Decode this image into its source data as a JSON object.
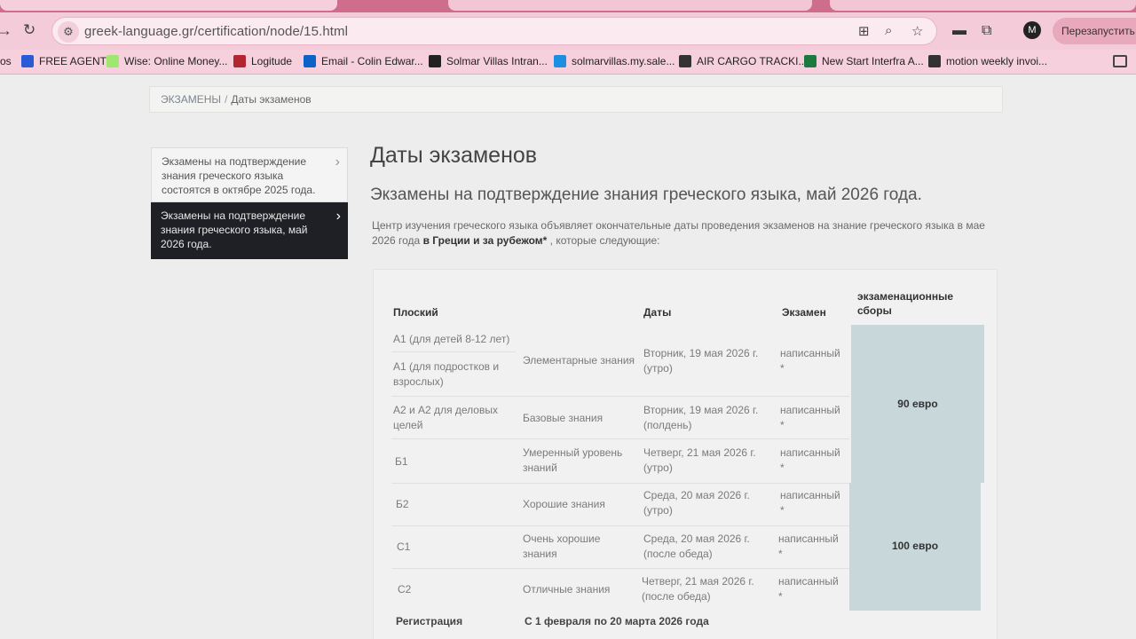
{
  "browser": {
    "url": "greek-language.gr/certification/node/15.html",
    "relaunch_label": "Перезапустить и",
    "profile_initial": "M",
    "bookmarks": [
      {
        "label": "FREE AGENT",
        "color": "#2a5bd7"
      },
      {
        "label": "Wise: Online Money...",
        "color": "#9fe870"
      },
      {
        "label": "Logitude",
        "color": "#b3262f"
      },
      {
        "label": "Email - Colin Edwar...",
        "color": "#0a64c8"
      },
      {
        "label": "Solmar Villas Intran...",
        "color": "#222222"
      },
      {
        "label": "solmarvillas.my.sale...",
        "color": "#1d8fe1"
      },
      {
        "label": "AIR CARGO TRACKI...",
        "color": "#333333"
      },
      {
        "label": "New Start Interfra A...",
        "color": "#1d7a3e"
      },
      {
        "label": "motion weekly invoi...",
        "color": "#333333"
      }
    ]
  },
  "breadcrumb": {
    "parent": "ЭКЗАМЕНЫ",
    "separator": "/",
    "current": "Даты экзаменов"
  },
  "sidebar": {
    "items": [
      {
        "label": "Экзамены на подтверждение знания греческого языка состоятся в октябре 2025 года.",
        "active": false
      },
      {
        "label": "Экзамены на подтверждение знания греческого языка, май 2026 года.",
        "active": true
      }
    ]
  },
  "main": {
    "title": "Даты экзаменов",
    "subtitle": "Экзамены на подтверждение знания греческого языка, май 2026 года.",
    "intro_text": "Центр изучения греческого языка объявляет окончательные даты проведения экзаменов на знание греческого языка в мае 2026 года ",
    "intro_bold": "в Греции и за рубежом*",
    "intro_tail": " , которые следующие:"
  },
  "table": {
    "headers": {
      "level": "Плоский",
      "dates": "Даты",
      "exam": "Экзамен",
      "fees": "экзаменационные сборы"
    },
    "rows": [
      {
        "levels": [
          "А1 (для детей 8-12 лет)",
          "А1 (для подростков и взрослых)"
        ],
        "name": "Элементарные знания",
        "date": "Вторник, 19 мая 2026 г. (утро)",
        "exam": "написанный *"
      },
      {
        "levels": [
          "А2 и А2 для деловых целей"
        ],
        "name": "Базовые знания",
        "date": "Вторник, 19 мая 2026 г. (полдень)",
        "exam": "написанный *"
      },
      {
        "levels": [
          "Б1"
        ],
        "name": "Умеренный уровень знаний",
        "date": "Четверг, 21 мая 2026 г. (утро)",
        "exam": "написанный *"
      },
      {
        "levels": [
          "Б2"
        ],
        "name": "Хорошие знания",
        "date": "Среда, 20 мая 2026 г. (утро)",
        "exam": "написанный *"
      },
      {
        "levels": [
          "С1"
        ],
        "name": "Очень хорошие знания",
        "date": "Среда, 20 мая 2026 г. (после обеда)",
        "exam": "написанный *"
      },
      {
        "levels": [
          "С2"
        ],
        "name": "Отличные знания",
        "date": "Четверг, 21 мая 2026 г. (после обеда)",
        "exam": "написанный *"
      }
    ],
    "fees": [
      "90 евро",
      "100 евро"
    ],
    "registration_label": "Регистрация",
    "registration_value": "С 1 февраля по 20 марта 2026 года"
  },
  "colors": {
    "browser_accent": "#cf6d8d",
    "active_sidebar": "#1f1f26",
    "fee_cell": "#c8d7da"
  }
}
